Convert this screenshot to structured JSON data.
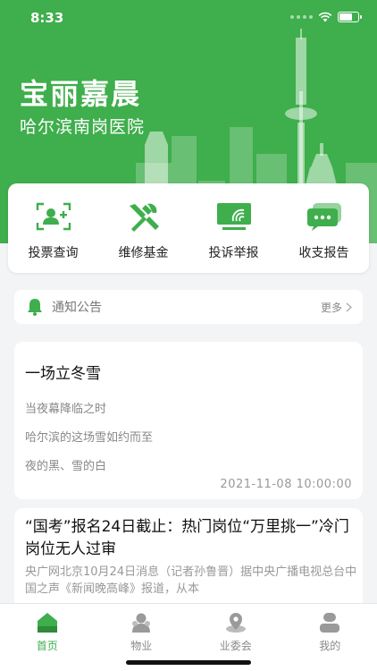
{
  "status_bar": {
    "time": "8:33"
  },
  "header": {
    "community_name": "宝丽嘉晨",
    "community_sub": "哈尔滨南岗医院"
  },
  "quick_actions": [
    {
      "label": "投票查询",
      "icon": "vote-user-icon"
    },
    {
      "label": "维修基金",
      "icon": "tools-icon"
    },
    {
      "label": "投诉举报",
      "icon": "complaint-screen-icon"
    },
    {
      "label": "收支报告",
      "icon": "chat-report-icon"
    }
  ],
  "notice": {
    "title": "通知公告",
    "more_label": "更多"
  },
  "articles": [
    {
      "title": "一场立冬雪",
      "lines": [
        "当夜幕降临之时",
        "哈尔滨的这场雪如约而至",
        "夜的黑、雪的白"
      ],
      "date": "2021-11-08 10:00:00"
    },
    {
      "title": "“国考”报名24日截止：热门岗位“万里挑一”冷门岗位无人过审",
      "excerpt": "央广网北京10月24日消息（记者孙鲁晋）据中央广播电视总台中国之声《新闻晚高峰》报道，从本"
    }
  ],
  "tabbar": [
    {
      "label": "首页",
      "icon": "home-icon",
      "active": true
    },
    {
      "label": "物业",
      "icon": "property-icon",
      "active": false
    },
    {
      "label": "业委会",
      "icon": "committee-icon",
      "active": false
    },
    {
      "label": "我的",
      "icon": "profile-icon",
      "active": false
    }
  ],
  "colors": {
    "brand_green": "#3fae4c",
    "background": "#f3f4f6"
  }
}
